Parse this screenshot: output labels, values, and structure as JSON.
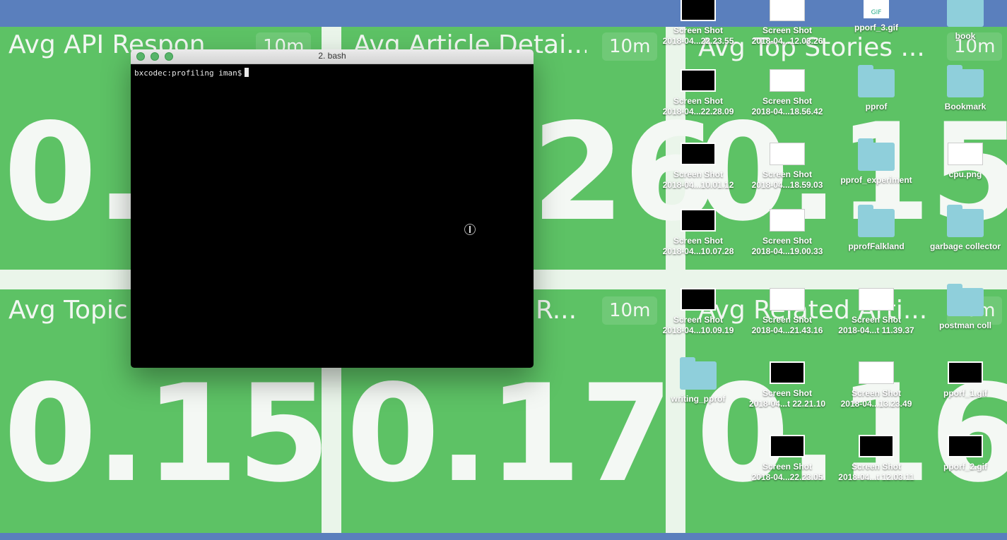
{
  "dashboard": {
    "tiles": [
      {
        "title": "Avg API Respon",
        "range": "10m",
        "value": "0.1"
      },
      {
        "title": "Avg Article Detai...",
        "range": "10m",
        "value": "26"
      },
      {
        "title": "Avg Top Stories ...",
        "range": "10m",
        "value": "0.15"
      },
      {
        "title": "Avg Topic",
        "range": "",
        "value": "0.15"
      },
      {
        "title": "R...",
        "range": "10m",
        "value": "0.17"
      },
      {
        "title": "Avg Related Arti...",
        "range": "10m",
        "value": "0.16"
      }
    ],
    "colors": {
      "background": "#5dc265",
      "menubar": "#5a7fbd"
    }
  },
  "terminal": {
    "title": "2. bash",
    "prompt": "bxcodec:profiling iman$"
  },
  "desktop": {
    "icons": [
      {
        "type": "thumb",
        "name": "Screen Shot",
        "sub": "2018-04...22.23.55"
      },
      {
        "type": "light",
        "name": "Screen Shot",
        "sub": "2018-04...12.03.26"
      },
      {
        "type": "gif",
        "name": "pporf_3.gif",
        "sub": "",
        "gif_label": "GIF"
      },
      {
        "type": "folder",
        "name": "book",
        "sub": ""
      },
      {
        "type": "thumb",
        "name": "Screen Shot",
        "sub": "2018-04...22.28.09"
      },
      {
        "type": "light",
        "name": "Screen Shot",
        "sub": "2018-04...18.56.42"
      },
      {
        "type": "folder",
        "name": "pprof",
        "sub": ""
      },
      {
        "type": "folder",
        "name": "Bookmark",
        "sub": ""
      },
      {
        "type": "thumb",
        "name": "Screen Shot",
        "sub": "2018-04...10.01.12"
      },
      {
        "type": "light",
        "name": "Screen Shot",
        "sub": "2018-04...18.59.03"
      },
      {
        "type": "folder",
        "name": "pprof_experiment",
        "sub": ""
      },
      {
        "type": "light",
        "name": "cpu.png",
        "sub": ""
      },
      {
        "type": "thumb",
        "name": "Screen Shot",
        "sub": "2018-04...10.07.28"
      },
      {
        "type": "light",
        "name": "Screen Shot",
        "sub": "2018-04...19.00.33"
      },
      {
        "type": "folder",
        "name": "pprofFalkland",
        "sub": ""
      },
      {
        "type": "folder",
        "name": "garbage collector",
        "sub": ""
      },
      {
        "type": "thumb",
        "name": "Screen Shot",
        "sub": "2018-04...10.09.19"
      },
      {
        "type": "light",
        "name": "Screen Shot",
        "sub": "2018-04...21.43.16"
      },
      {
        "type": "light",
        "name": "Screen Shot",
        "sub": "2018-04...t 11.39.37"
      },
      {
        "type": "folder",
        "name": "postman coll",
        "sub": ""
      },
      {
        "type": "folder",
        "name": "writing_pprof",
        "sub": ""
      },
      {
        "type": "thumb",
        "name": "Screen Shot",
        "sub": "2018-04...t 22.21.10"
      },
      {
        "type": "light",
        "name": "Screen Shot",
        "sub": "2018-04...13.23.49"
      },
      {
        "type": "thumb",
        "name": "pporf_1.gif",
        "sub": ""
      },
      {
        "type": "thumb",
        "name": "Screen Shot",
        "sub": "2018-04...22.23.05"
      },
      {
        "type": "thumb",
        "name": "Screen Shot",
        "sub": "2018-04...t 12.03.11"
      },
      {
        "type": "thumb",
        "name": "pporf_2.gif",
        "sub": ""
      }
    ]
  }
}
